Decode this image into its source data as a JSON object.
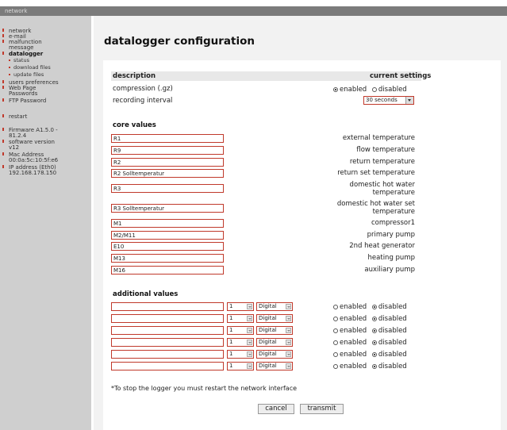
{
  "topbar": {
    "title": "network"
  },
  "sidebar": {
    "items": [
      {
        "label": "network",
        "bold": false,
        "sub": false
      },
      {
        "label": "e-mail",
        "bold": false,
        "sub": false
      },
      {
        "label": "malfunction message",
        "bold": false,
        "sub": false
      },
      {
        "label": "datalogger",
        "bold": true,
        "sub": false
      },
      {
        "label": "status",
        "bold": false,
        "sub": true
      },
      {
        "label": "download files",
        "bold": false,
        "sub": true
      },
      {
        "label": "update files",
        "bold": false,
        "sub": true
      },
      {
        "label": "users preferences",
        "bold": false,
        "sub": false
      },
      {
        "label": "Web Page Passwords",
        "bold": false,
        "sub": false
      },
      {
        "label": "FTP Password",
        "bold": false,
        "sub": false
      },
      {
        "label": "restart",
        "bold": false,
        "sub": false
      },
      {
        "label": "Firmware A1.5.0 - 81.2.4",
        "bold": false,
        "sub": false
      },
      {
        "label": "software version v12",
        "bold": false,
        "sub": false
      },
      {
        "label": "Mac Address 00:0a:5c:10:5f:e6",
        "bold": false,
        "sub": false
      },
      {
        "label": "IP address (Eth0) 192.168.178.150",
        "bold": false,
        "sub": false
      }
    ]
  },
  "page": {
    "title": "datalogger configuration"
  },
  "settings": {
    "description_header": "description",
    "current_header": "current settings",
    "compression_label": "compression (.gz)",
    "enabled_label": "enabled",
    "disabled_label": "disabled",
    "recording_label": "recording interval",
    "recording_value": "30 seconds"
  },
  "core": {
    "title": "core values",
    "rows": [
      {
        "field": "R1",
        "desc": "external temperature"
      },
      {
        "field": "R9",
        "desc": "flow temperature"
      },
      {
        "field": "R2",
        "desc": "return temperature"
      },
      {
        "field": "R2 Solltemperatur",
        "desc": "return set temperature"
      },
      {
        "field": "R3",
        "desc": "domestic hot water temperature"
      },
      {
        "field": "R3 Solltemperatur",
        "desc": "domestic hot water set temperature"
      },
      {
        "field": "M1",
        "desc": "compressor1"
      },
      {
        "field": "M2/M11",
        "desc": "primary pump"
      },
      {
        "field": "E10",
        "desc": "2nd heat generator"
      },
      {
        "field": "M13",
        "desc": "heating pump"
      },
      {
        "field": "M16",
        "desc": "auxiliary pump"
      }
    ]
  },
  "additional": {
    "title": "additional values",
    "rows": [
      {
        "field": "",
        "num": "1",
        "type": "Digital",
        "enabled": "enabled",
        "disabled": "disabled"
      },
      {
        "field": "",
        "num": "1",
        "type": "Digital",
        "enabled": "enabled",
        "disabled": "disabled"
      },
      {
        "field": "",
        "num": "1",
        "type": "Digital",
        "enabled": "enabled",
        "disabled": "disabled"
      },
      {
        "field": "",
        "num": "1",
        "type": "Digital",
        "enabled": "enabled",
        "disabled": "disabled"
      },
      {
        "field": "",
        "num": "1",
        "type": "Digital",
        "enabled": "enabled",
        "disabled": "disabled"
      },
      {
        "field": "",
        "num": "1",
        "type": "Digital",
        "enabled": "enabled",
        "disabled": "disabled"
      }
    ]
  },
  "footer": {
    "note": "*To stop the logger you must restart the network interface",
    "cancel_label": "cancel",
    "transmit_label": "transmit"
  }
}
